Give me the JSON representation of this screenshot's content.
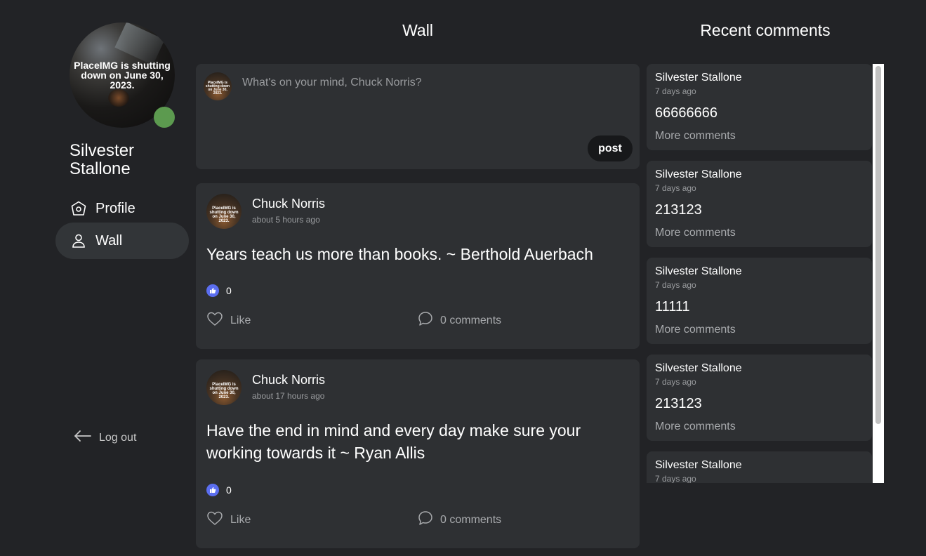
{
  "sidebar": {
    "avatar_text": "PlaceIMG is shutting down on June 30, 2023.",
    "user_name": "Silvester Stallone",
    "nav": [
      {
        "label": "Profile",
        "icon": "home-pentagon-icon"
      },
      {
        "label": "Wall",
        "icon": "user-icon",
        "active": true
      }
    ],
    "logout_label": "Log out"
  },
  "wall": {
    "title": "Wall",
    "composer": {
      "placeholder": "What's on your mind, Chuck Norris?",
      "post_label": "post",
      "avatar_text": "PlaceIMG is shutting down on June 30, 2023."
    },
    "posts": [
      {
        "author": "Chuck Norris",
        "time": "about 5 hours ago",
        "text": "Years teach us more than books. ~ Berthold Auerbach",
        "likes": "0",
        "like_label": "Like",
        "comments_label": "0 comments",
        "avatar_text": "PlaceIMG is shutting down on June 30, 2023."
      },
      {
        "author": "Chuck Norris",
        "time": "about 17 hours ago",
        "text": "Have the end in mind and every day make sure your working towards it ~ Ryan Allis",
        "likes": "0",
        "like_label": "Like",
        "comments_label": "0 comments",
        "avatar_text": "PlaceIMG is shutting down on June 30, 2023."
      }
    ]
  },
  "recent_comments": {
    "title": "Recent comments",
    "items": [
      {
        "author": "Silvester Stallone",
        "time": "7 days ago",
        "text": "66666666",
        "more": "More comments"
      },
      {
        "author": "Silvester Stallone",
        "time": "7 days ago",
        "text": "213123",
        "more": "More comments"
      },
      {
        "author": "Silvester Stallone",
        "time": "7 days ago",
        "text": "11111",
        "more": "More comments"
      },
      {
        "author": "Silvester Stallone",
        "time": "7 days ago",
        "text": "213123",
        "more": "More comments"
      },
      {
        "author": "Silvester Stallone",
        "time": "7 days ago",
        "text": "",
        "more": ""
      }
    ]
  },
  "colors": {
    "background": "#222326",
    "card": "#2e3033",
    "online": "#5c9a4f",
    "like_badge": "#5b6ef0"
  }
}
